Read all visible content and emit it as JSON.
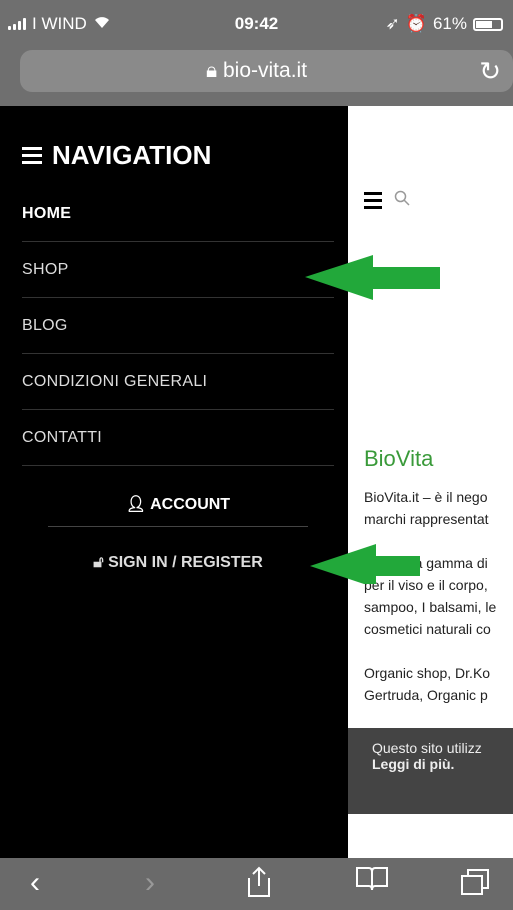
{
  "status": {
    "carrier": "I WIND",
    "time": "09:42",
    "battery": "61%",
    "battery_level": 0.61
  },
  "browser": {
    "url": "bio-vita.it"
  },
  "drawer": {
    "title": "NAVIGATION",
    "items": [
      {
        "label": "HOME"
      },
      {
        "label": "SHOP"
      },
      {
        "label": "BLOG"
      },
      {
        "label": "CONDIZIONI GENERALI"
      },
      {
        "label": "CONTATTI"
      }
    ],
    "account": "ACCOUNT",
    "signin": "SIGN IN / REGISTER"
  },
  "content": {
    "heading": "BioVita",
    "lines": [
      "BioVita.it – è il nego",
      "marchi rappresentat",
      "",
      "La nostra gamma di",
      "per il viso e il corpo,",
      "sampoo, I balsami, le",
      "cosmetici naturali co",
      "",
      "Organic shop, Dr.Ko",
      "Gertruda, Organic p"
    ]
  },
  "cookie": {
    "text": "Questo sito utilizz",
    "link": "Leggi di più."
  },
  "colors": {
    "accent": "#3a9a3a",
    "annotation_arrow": "#22a83a"
  }
}
